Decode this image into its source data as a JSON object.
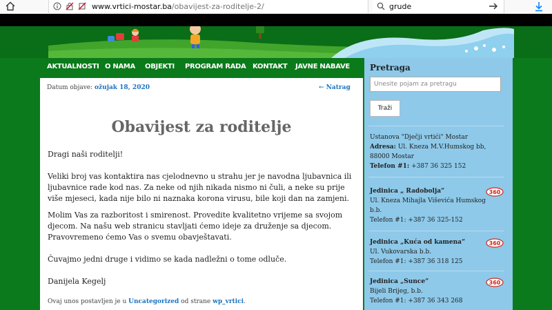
{
  "browser": {
    "url_host": "www.vrtici-mostar.ba",
    "url_path": "/obavijest-za-roditelje-2/",
    "page_actions": "•••",
    "search_value": "grude"
  },
  "nav": {
    "items": [
      "AKTUALNOSTI",
      "O NAMA",
      "OBJEKTI",
      "PROGRAM RADA",
      "KONTAKT",
      "JAVNE NABAVE"
    ]
  },
  "post": {
    "date_label": "Datum objave: ",
    "date_value": "ožujak 18, 2020",
    "back_link": "← Natrag",
    "title": "Obavijest za roditelje",
    "paragraphs": [
      "Dragi naši roditelji!",
      "Veliki broj vas kontaktira nas cjelodnevno u strahu jer je navodna ljubavnica ili ljubavnice rade kod nas. Za neke od njih nikada nismo ni čuli, a neke su prije više mjeseci, kada nije bilo ni naznaka korona virusu, bile koji dan na zamjeni.",
      "Molim Vas za razboritost i smirenost. Provedite kvalitetno vrijeme sa svojom djecom. Na našu web stranicu stavljati ćemo ideje za druženje sa djecom. Pravovremeno ćemo Vas o svemu obavještavati.",
      "Čuvajmo jedni druge i vidimo se kada nadležni o tome odluče.",
      "Danijela Kegelj"
    ],
    "footer_prefix": "Ovaj unos postavljen je u ",
    "footer_category": "Uncategorized",
    "footer_middle": " od strane ",
    "footer_author": "wp_vrtici",
    "footer_suffix": "."
  },
  "sidebar": {
    "search_title": "Pretraga",
    "search_placeholder": "Unesite pojam za pretragu",
    "search_button": "Traži",
    "org": {
      "name": "Ustanova \"Dječji vrtići\" Mostar",
      "address_label": "Adresa:",
      "address_value": " Ul. Kneza M.V.Humskog bb,",
      "city": "88000 Mostar",
      "phone_label": "Telefon #1:",
      "phone_value": " +387 36 325 152"
    },
    "units": [
      {
        "name": "Jedinica „ Radobolja“",
        "address": "Ul. Kneza Mihajla Viševića Humskog b.b.",
        "phone": "Telefon #1: +387 36 325-152",
        "badge": "360"
      },
      {
        "name": "Jedinica „Kuća od kamena“",
        "address": "Ul. Vukovarska b.b.",
        "phone": "Telefon #1: +387 36 318 125",
        "badge": "360"
      },
      {
        "name": "Jedinica „Sunce“",
        "address": "Bijeli Brijeg, b.b.",
        "phone": "Telefon #1: +387 36 343 268",
        "badge": "360"
      }
    ]
  }
}
